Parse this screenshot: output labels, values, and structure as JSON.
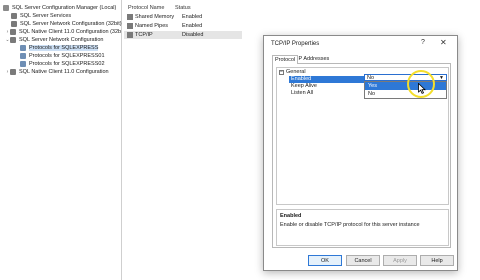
{
  "tree": {
    "items": [
      {
        "label": "SQL Server Configuration Manager (Local)",
        "expander": "",
        "icon_color": "#8a8a8a"
      },
      {
        "label": "SQL Server Services",
        "expander": "",
        "icon_color": "#7a7a7a"
      },
      {
        "label": "SQL Server Network Configuration (32bit)",
        "expander": "",
        "icon_color": "#7a7a7a"
      },
      {
        "label": "SQL Native Client 11.0 Configuration (32b",
        "expander": "›",
        "icon_color": "#7a7a7a"
      },
      {
        "label": "SQL Server Network Configuration",
        "expander": "⌄",
        "icon_color": "#7a7a7a"
      },
      {
        "label": "Protocols for SQLEXPRESS",
        "expander": "",
        "icon_color": "#6f8fb5"
      },
      {
        "label": "Protocols for SQLEXPRESS01",
        "expander": "",
        "icon_color": "#6f8fb5"
      },
      {
        "label": "Protocols for SQLEXPRESS02",
        "expander": "",
        "icon_color": "#6f8fb5"
      },
      {
        "label": "SQL Native Client 11.0 Configuration",
        "expander": "›",
        "icon_color": "#7a7a7a"
      }
    ],
    "selected_index": 5
  },
  "list": {
    "headers": {
      "name": "Protocol Name",
      "status": "Status"
    },
    "rows": [
      {
        "name": "Shared Memory",
        "status": "Enabled"
      },
      {
        "name": "Named Pipes",
        "status": "Enabled"
      },
      {
        "name": "TCP/IP",
        "status": "Disabled"
      }
    ],
    "selected_index": 2
  },
  "dialog": {
    "title": "TCP/IP Properties",
    "help_glyph": "?",
    "close_glyph": "✕",
    "tabs": [
      {
        "label": "Protocol"
      },
      {
        "label": "IP Addresses"
      }
    ],
    "active_tab": 0,
    "grid": {
      "category": "General",
      "category_toggle": "−",
      "rows": [
        {
          "name": "Enabled",
          "value": "No"
        },
        {
          "name": "Keep Alive",
          "value": ""
        },
        {
          "name": "Listen All",
          "value": ""
        }
      ]
    },
    "dropdown": {
      "value": "No",
      "arrow": "▼",
      "options": [
        "Yes",
        "No"
      ],
      "highlighted_index": 0
    },
    "description": {
      "title": "Enabled",
      "text": "Enable or disable TCP/IP protocol for this server instance"
    },
    "buttons": {
      "ok": "OK",
      "cancel": "Cancel",
      "apply": "Apply",
      "help": "Help"
    }
  },
  "colors": {
    "selection_blue": "#2e78d6",
    "cursor_highlight": "#f4de2a"
  }
}
